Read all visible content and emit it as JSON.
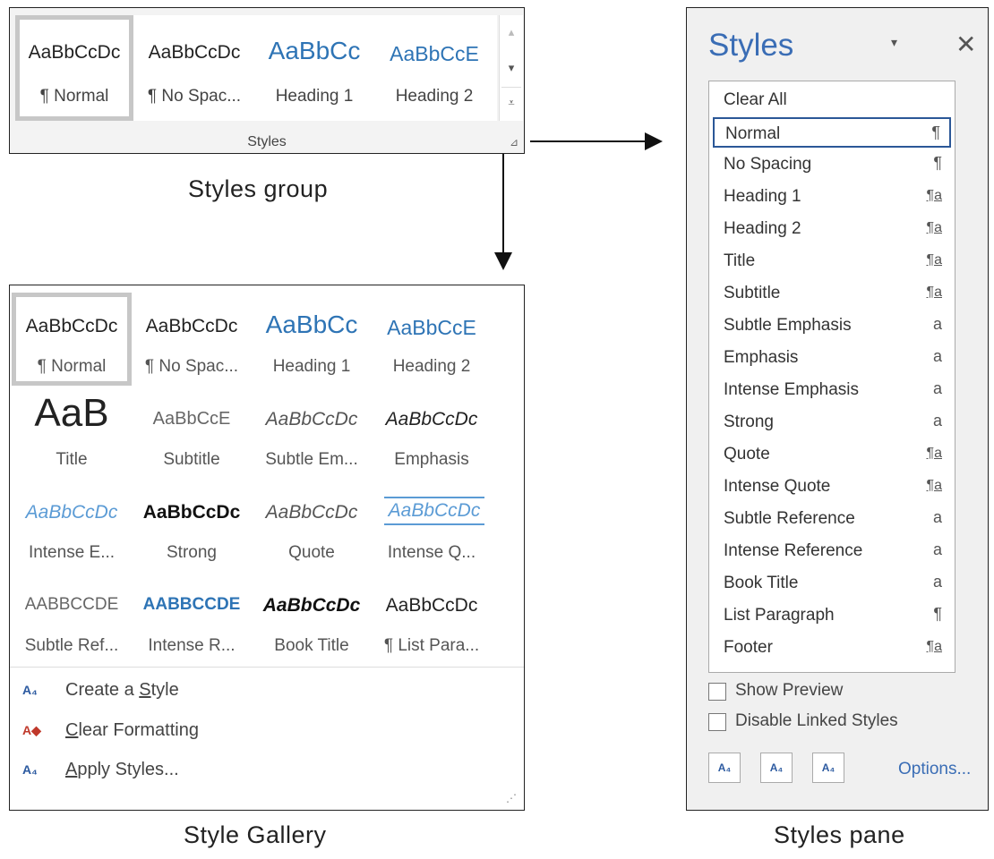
{
  "ribbon": {
    "tiles": [
      {
        "sample": "AaBbCcDc",
        "name": "¶ Normal",
        "color": "#222222"
      },
      {
        "sample": "AaBbCcDc",
        "name": "¶ No Spac...",
        "color": "#222222"
      },
      {
        "sample": "AaBbCc",
        "name": "Heading 1",
        "color": "#2e74b5"
      },
      {
        "sample": "AaBbCcE",
        "name": "Heading 2",
        "color": "#2e74b5"
      }
    ],
    "caption": "Styles",
    "scroll_up": "▴",
    "scroll_down": "▾",
    "more": "⩡",
    "launcher": "⊿"
  },
  "captions": {
    "group": "Styles group",
    "gallery": "Style Gallery",
    "pane": "Styles pane"
  },
  "gallery": {
    "rows": [
      [
        {
          "sample": "AaBbCcDc",
          "name": "¶ Normal",
          "color": "#222222"
        },
        {
          "sample": "AaBbCcDc",
          "name": "¶ No Spac...",
          "color": "#222222"
        },
        {
          "sample": "AaBbCc",
          "name": "Heading 1",
          "color": "#2e74b5"
        },
        {
          "sample": "AaBbCcE",
          "name": "Heading 2",
          "color": "#2e74b5"
        }
      ],
      [
        {
          "sample": "AaB",
          "name": "Title",
          "color": "#222222"
        },
        {
          "sample": "AaBbCcE",
          "name": "Subtitle",
          "color": "#666666"
        },
        {
          "sample": "AaBbCcDc",
          "name": "Subtle Em...",
          "color": "#555555"
        },
        {
          "sample": "AaBbCcDc",
          "name": "Emphasis",
          "color": "#222222"
        }
      ],
      [
        {
          "sample": "AaBbCcDc",
          "name": "Intense E...",
          "color": "#5b9bd5"
        },
        {
          "sample": "AaBbCcDc",
          "name": "Strong",
          "color": "#111111"
        },
        {
          "sample": "AaBbCcDc",
          "name": "Quote",
          "color": "#555555"
        },
        {
          "sample": "AaBbCcDc",
          "name": "Intense Q...",
          "color": "#5b9bd5"
        }
      ],
      [
        {
          "sample": "AABBCCDE",
          "name": "Subtle Ref...",
          "color": "#666666"
        },
        {
          "sample": "AABBCCDE",
          "name": "Intense R...",
          "color": "#2e74b5"
        },
        {
          "sample": "AaBbCcDc",
          "name": "Book Title",
          "color": "#111111"
        },
        {
          "sample": "AaBbCcDc",
          "name": "¶ List Para...",
          "color": "#222222"
        }
      ]
    ],
    "commands": [
      {
        "icon": "A₄",
        "pre": "Create a ",
        "ul": "S",
        "post": "tyle"
      },
      {
        "icon": "A◆",
        "pre": "",
        "ul": "C",
        "post": "lear Formatting"
      },
      {
        "icon": "A₄",
        "pre": "",
        "ul": "A",
        "post": "pply Styles..."
      }
    ],
    "grip": "⋰"
  },
  "pane": {
    "title": "Styles",
    "menu": "▾",
    "close": "✕",
    "items": [
      {
        "label": "Clear All",
        "mark": ""
      },
      {
        "label": "Normal",
        "mark": "¶"
      },
      {
        "label": "No Spacing",
        "mark": "¶"
      },
      {
        "label": "Heading 1",
        "mark": "¶a"
      },
      {
        "label": "Heading 2",
        "mark": "¶a"
      },
      {
        "label": "Title",
        "mark": "¶a"
      },
      {
        "label": "Subtitle",
        "mark": "¶a"
      },
      {
        "label": "Subtle Emphasis",
        "mark": "a"
      },
      {
        "label": "Emphasis",
        "mark": "a"
      },
      {
        "label": "Intense Emphasis",
        "mark": "a"
      },
      {
        "label": "Strong",
        "mark": "a"
      },
      {
        "label": "Quote",
        "mark": "¶a"
      },
      {
        "label": "Intense Quote",
        "mark": "¶a"
      },
      {
        "label": "Subtle Reference",
        "mark": "a"
      },
      {
        "label": "Intense Reference",
        "mark": "a"
      },
      {
        "label": "Book Title",
        "mark": "a"
      },
      {
        "label": "List Paragraph",
        "mark": "¶"
      },
      {
        "label": "Footer",
        "mark": "¶a"
      }
    ],
    "selected_index": 1,
    "show_preview": "Show Preview",
    "disable_linked": "Disable Linked Styles",
    "buttons": [
      "A₄",
      "A₄",
      "A₄"
    ],
    "options": "Options..."
  }
}
